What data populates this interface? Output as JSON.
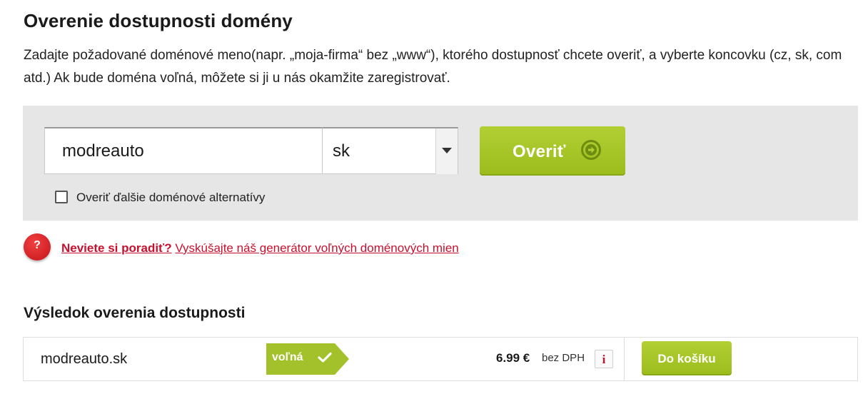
{
  "page": {
    "title": "Overenie dostupnosti domény",
    "description": "Zadajte požadované doménové meno(napr. „moja-firma“ bez „www“), ktorého dostupnosť chcete overiť, a vyberte koncovku (cz, sk, com atd.) Ak bude doména voľná, môžete si ji u nás okamžite zaregistrovať."
  },
  "search": {
    "domain_value": "modreauto",
    "tld_selected": "sk",
    "verify_label": "Overiť",
    "alternatives_label": "Overiť ďalšie doménové alternatívy",
    "alternatives_checked": false
  },
  "help": {
    "icon_symbol": "?",
    "bold_text": "Neviete si poradiť?",
    "link_text": "Vyskúšajte náš generátor voľných doménových mien"
  },
  "results": {
    "title": "Výsledok overenia dostupnosti",
    "rows": [
      {
        "domain": "modreauto.sk",
        "status": "voľná",
        "price": "6.99 €",
        "price_note": "bez DPH",
        "info_symbol": "i",
        "cart_label": "Do košíku"
      }
    ]
  },
  "colors": {
    "accent_green": "#a3c12a",
    "link_red": "#c8102e",
    "panel_gray": "#e6e6e6"
  }
}
